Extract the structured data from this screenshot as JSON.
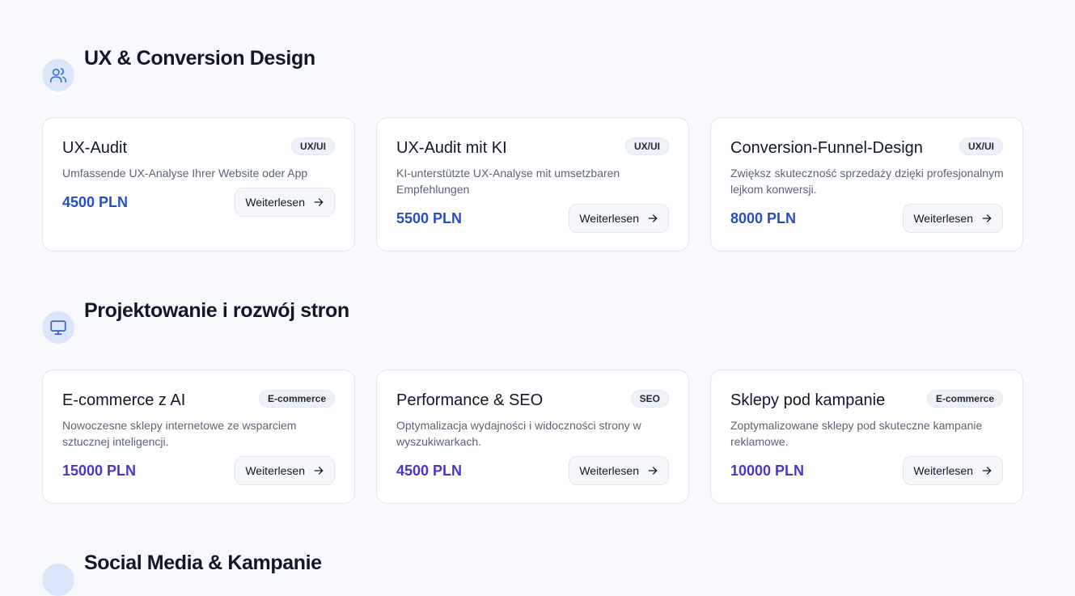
{
  "sections": [
    {
      "title": "UX & Conversion Design",
      "icon": "users-icon",
      "cards": [
        {
          "title": "UX-Audit",
          "badge": "UX/UI",
          "description": "Umfassende UX-Analyse Ihrer Website oder App",
          "price": "4500 PLN",
          "button": "Weiterlesen"
        },
        {
          "title": "UX-Audit mit KI",
          "badge": "UX/UI",
          "description": "KI-unterstützte UX-Analyse mit umsetzbaren Empfehlungen",
          "price": "5500 PLN",
          "button": "Weiterlesen"
        },
        {
          "title": "Conversion-Funnel-Design",
          "badge": "UX/UI",
          "description": "Zwiększ skuteczność sprzedaży dzięki profesjonalnym lejkom konwersji.",
          "price": "8000 PLN",
          "button": "Weiterlesen"
        }
      ]
    },
    {
      "title": "Projektowanie i rozwój stron",
      "icon": "monitor-icon",
      "cards": [
        {
          "title": "E-commerce z AI",
          "badge": "E-commerce",
          "description": "Nowoczesne sklepy internetowe ze wsparciem sztucznej inteligencji.",
          "price": "15000 PLN",
          "button": "Weiterlesen"
        },
        {
          "title": "Performance & SEO",
          "badge": "SEO",
          "description": "Optymalizacja wydajności i widoczności strony w wyszukiwarkach.",
          "price": "4500 PLN",
          "button": "Weiterlesen"
        },
        {
          "title": "Sklepy pod kampanie",
          "badge": "E-commerce",
          "description": "Zoptymalizowane sklepy pod skuteczne kampanie reklamowe.",
          "price": "10000 PLN",
          "button": "Weiterlesen"
        }
      ]
    },
    {
      "title": "Social Media & Kampanie",
      "icon": "section-icon"
    }
  ],
  "colors": {
    "background": "#f8f9fc",
    "price_blue": "#2a4cc4",
    "price_violet": "#4a37c6",
    "icon_circle": "#dbe6fb",
    "icon_stroke": "#3b6fd8"
  }
}
